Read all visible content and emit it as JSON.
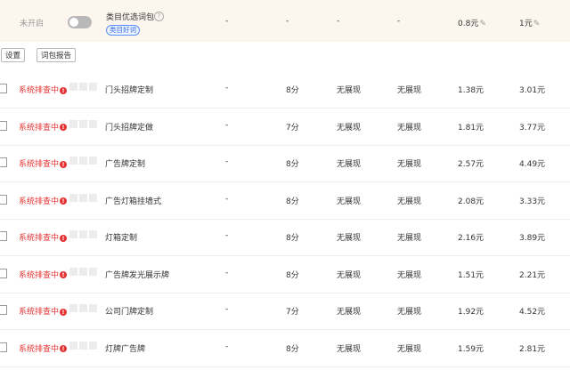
{
  "category_row": {
    "state": "未开启",
    "name": "类目优选词包",
    "tag": "类目好词",
    "col1": "-",
    "col2": "-",
    "col3": "-",
    "col4": "-",
    "price": "0.8元",
    "bid": "1元"
  },
  "toolbar": {
    "settings_label": "设置",
    "report_label": "词包报告"
  },
  "rows": [
    {
      "status": "系统排查中",
      "keyword": "门头招牌定制",
      "col1": "-",
      "quality": "8分",
      "col3": "无展现",
      "col4": "无展现",
      "price": "1.38元",
      "bid": "3.01元"
    },
    {
      "status": "系统排查中",
      "keyword": "门头招牌定做",
      "col1": "-",
      "quality": "7分",
      "col3": "无展现",
      "col4": "无展现",
      "price": "1.81元",
      "bid": "3.77元"
    },
    {
      "status": "系统排查中",
      "keyword": "广告牌定制",
      "col1": "-",
      "quality": "8分",
      "col3": "无展现",
      "col4": "无展现",
      "price": "2.57元",
      "bid": "4.49元"
    },
    {
      "status": "系统排查中",
      "keyword": "广告灯箱挂墙式",
      "col1": "-",
      "quality": "8分",
      "col3": "无展现",
      "col4": "无展现",
      "price": "2.08元",
      "bid": "3.33元"
    },
    {
      "status": "系统排查中",
      "keyword": "灯箱定制",
      "col1": "-",
      "quality": "8分",
      "col3": "无展现",
      "col4": "无展现",
      "price": "2.16元",
      "bid": "3.89元"
    },
    {
      "status": "系统排查中",
      "keyword": "广告牌发光展示牌",
      "col1": "-",
      "quality": "8分",
      "col3": "无展现",
      "col4": "无展现",
      "price": "1.51元",
      "bid": "2.21元"
    },
    {
      "status": "系统排查中",
      "keyword": "公司门牌定制",
      "col1": "-",
      "quality": "7分",
      "col3": "无展现",
      "col4": "无展现",
      "price": "1.92元",
      "bid": "4.52元"
    },
    {
      "status": "系统排查中",
      "keyword": "灯牌广告牌",
      "col1": "-",
      "quality": "8分",
      "col3": "无展现",
      "col4": "无展现",
      "price": "1.59元",
      "bid": "2.81元"
    }
  ]
}
